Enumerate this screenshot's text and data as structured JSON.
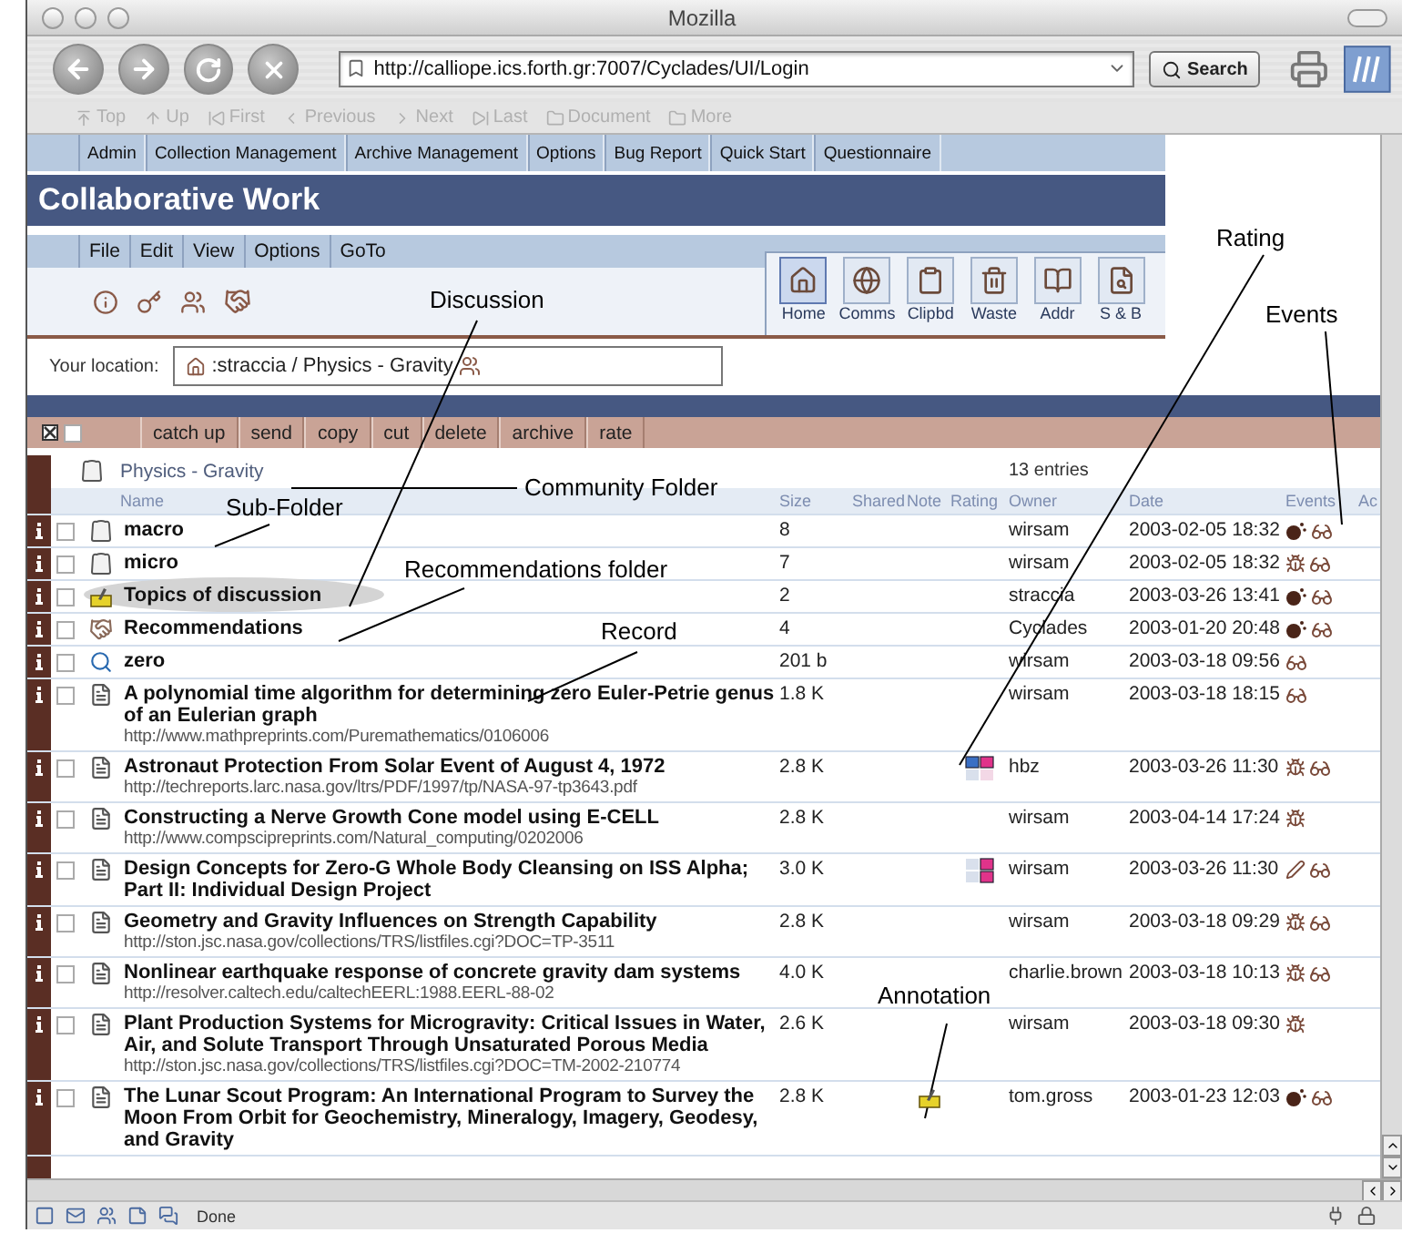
{
  "window": {
    "title": "Mozilla"
  },
  "navigation": {
    "url": "http://calliope.ics.forth.gr:7007/Cyclades/UI/Login",
    "search_button": "Search"
  },
  "link_bar": [
    {
      "kind": "top",
      "label": "Top",
      "disabled": true
    },
    {
      "kind": "up",
      "label": "Up",
      "disabled": true
    },
    {
      "kind": "first",
      "label": "First",
      "disabled": true
    },
    {
      "kind": "previous",
      "label": "Previous",
      "disabled": true
    },
    {
      "kind": "next",
      "label": "Next",
      "disabled": true
    },
    {
      "kind": "last",
      "label": "Last",
      "disabled": true
    },
    {
      "kind": "folder",
      "label": "Document",
      "disabled": true
    },
    {
      "kind": "folder",
      "label": "More",
      "disabled": true
    }
  ],
  "site_menu": [
    "Admin",
    "Collection Management",
    "Archive Management",
    "Options",
    "Bug Report",
    "Quick Start",
    "Questionnaire"
  ],
  "banner": "Collaborative Work",
  "menu": [
    "File",
    "Edit",
    "View",
    "Options",
    "GoTo"
  ],
  "tools": [
    {
      "kind": "home",
      "label": "Home",
      "selected": true
    },
    {
      "kind": "comms",
      "label": "Comms",
      "selected": false
    },
    {
      "kind": "clipboard",
      "label": "Clipbd",
      "selected": false
    },
    {
      "kind": "waste",
      "label": "Waste",
      "selected": false
    },
    {
      "kind": "address",
      "label": "Addr",
      "selected": false
    },
    {
      "kind": "search",
      "label": "S & B",
      "selected": false
    }
  ],
  "location": {
    "label": "Your location:",
    "path": ":straccia / Physics - Gravity"
  },
  "select_all": {
    "checked": false
  },
  "actions": [
    "catch up",
    "send",
    "copy",
    "cut",
    "delete",
    "archive",
    "rate"
  ],
  "folder": {
    "name": "Physics - Gravity",
    "count": "13 entries"
  },
  "columns": [
    "Name",
    "Size",
    "Shared",
    "Note",
    "Rating",
    "Owner",
    "Date",
    "Events",
    "Ac"
  ],
  "rows": [
    {
      "kind": "folder",
      "title": "macro",
      "size": "8",
      "owner": "wirsam",
      "date": "2003-02-05 18:32",
      "events": [
        {
          "kind": "new"
        },
        {
          "kind": "read"
        }
      ],
      "checked": false,
      "highlighted": false
    },
    {
      "kind": "folder",
      "title": "micro",
      "size": "7",
      "owner": "wirsam",
      "date": "2003-02-05 18:32",
      "events": [
        {
          "kind": "modified"
        },
        {
          "kind": "read"
        }
      ],
      "checked": false,
      "highlighted": false
    },
    {
      "kind": "discussion",
      "title": "Topics of discussion",
      "size": "2",
      "owner": "straccia",
      "date": "2003-03-26 13:41",
      "events": [
        {
          "kind": "new"
        },
        {
          "kind": "read"
        }
      ],
      "checked": false,
      "highlighted": true
    },
    {
      "kind": "recommendations",
      "title": "Recommendations",
      "size": "4",
      "owner": "Cyclades",
      "date": "2003-01-20 20:48",
      "events": [
        {
          "kind": "new"
        },
        {
          "kind": "read"
        }
      ],
      "checked": false,
      "highlighted": false
    },
    {
      "kind": "query",
      "title": "zero",
      "size": "201 b",
      "owner": "wirsam",
      "date": "2003-03-18 09:56",
      "events": [
        {
          "kind": "read"
        }
      ],
      "checked": false,
      "highlighted": false
    },
    {
      "kind": "record",
      "title": "A polynomial time algorithm for determining zero Euler-Petrie genus of an Eulerian graph",
      "url": "http://www.mathpreprints.com/Puremathematics/0106006",
      "size": "1.8 K",
      "owner": "wirsam",
      "date": "2003-03-18 18:15",
      "events": [
        {
          "kind": "read"
        }
      ],
      "checked": false,
      "highlighted": false
    },
    {
      "kind": "record",
      "title": "Astronaut Protection From Solar Event of August 4, 1972",
      "url": "http://techreports.larc.nasa.gov/ltrs/PDF/1997/tp/NASA-97-tp3643.pdf",
      "size": "2.8 K",
      "rating": {
        "kind": "horizontal"
      },
      "owner": "hbz",
      "date": "2003-03-26 11:30",
      "events": [
        {
          "kind": "modified"
        },
        {
          "kind": "read"
        }
      ],
      "checked": false,
      "highlighted": false
    },
    {
      "kind": "record",
      "title": "Constructing a Nerve Growth Cone model using E-CELL",
      "url": "http://www.compscipreprints.com/Natural_computing/0202006",
      "size": "2.8 K",
      "owner": "wirsam",
      "date": "2003-04-14 17:24",
      "events": [
        {
          "kind": "modified"
        }
      ],
      "checked": false,
      "highlighted": false
    },
    {
      "kind": "record",
      "title": "Design Concepts for Zero-G Whole Body Cleansing on ISS Alpha; Part II: Individual Design Project",
      "size": "3.0 K",
      "rating": {
        "kind": "vertical"
      },
      "owner": "wirsam",
      "date": "2003-03-26 11:30",
      "events": [
        {
          "kind": "annotated"
        },
        {
          "kind": "read"
        }
      ],
      "checked": false,
      "highlighted": false
    },
    {
      "kind": "record",
      "title": "Geometry and Gravity Influences on Strength Capability",
      "url": "http://ston.jsc.nasa.gov/collections/TRS/listfiles.cgi?DOC=TP-3511",
      "size": "2.8 K",
      "owner": "wirsam",
      "date": "2003-03-18 09:29",
      "events": [
        {
          "kind": "modified"
        },
        {
          "kind": "read"
        }
      ],
      "checked": false,
      "highlighted": false
    },
    {
      "kind": "record",
      "title": "Nonlinear earthquake response of concrete gravity dam systems",
      "url": "http://resolver.caltech.edu/caltechEERL:1988.EERL-88-02",
      "size": "4.0 K",
      "owner": "charlie.brown",
      "date": "2003-03-18 10:13",
      "events": [
        {
          "kind": "modified"
        },
        {
          "kind": "read"
        }
      ],
      "checked": false,
      "highlighted": false
    },
    {
      "kind": "record",
      "title": "Plant Production Systems for Microgravity: Critical Issues in Water, Air, and Solute Transport Through Unsaturated Porous Media",
      "url": "http://ston.jsc.nasa.gov/collections/TRS/listfiles.cgi?DOC=TM-2002-210774",
      "size": "2.6 K",
      "owner": "wirsam",
      "date": "2003-03-18 09:30",
      "events": [
        {
          "kind": "modified"
        }
      ],
      "checked": false,
      "highlighted": false
    },
    {
      "kind": "record",
      "title": "The Lunar Scout Program: An International Program to Survey the Moon From Orbit for Geochemistry, Mineralogy, Imagery, Geodesy, and Gravity",
      "size": "2.8 K",
      "note": true,
      "owner": "tom.gross",
      "date": "2003-01-23 12:03",
      "events": [
        {
          "kind": "new"
        },
        {
          "kind": "read"
        }
      ],
      "checked": false,
      "highlighted": false
    }
  ],
  "status_bar": {
    "text": "Done"
  },
  "annotations": [
    {
      "label": "Discussion"
    },
    {
      "label": "Rating"
    },
    {
      "label": "Events"
    },
    {
      "label": "Community Folder"
    },
    {
      "label": "Sub-Folder"
    },
    {
      "label": "Recommendations folder"
    },
    {
      "label": "Record"
    },
    {
      "label": "Annotation"
    }
  ]
}
